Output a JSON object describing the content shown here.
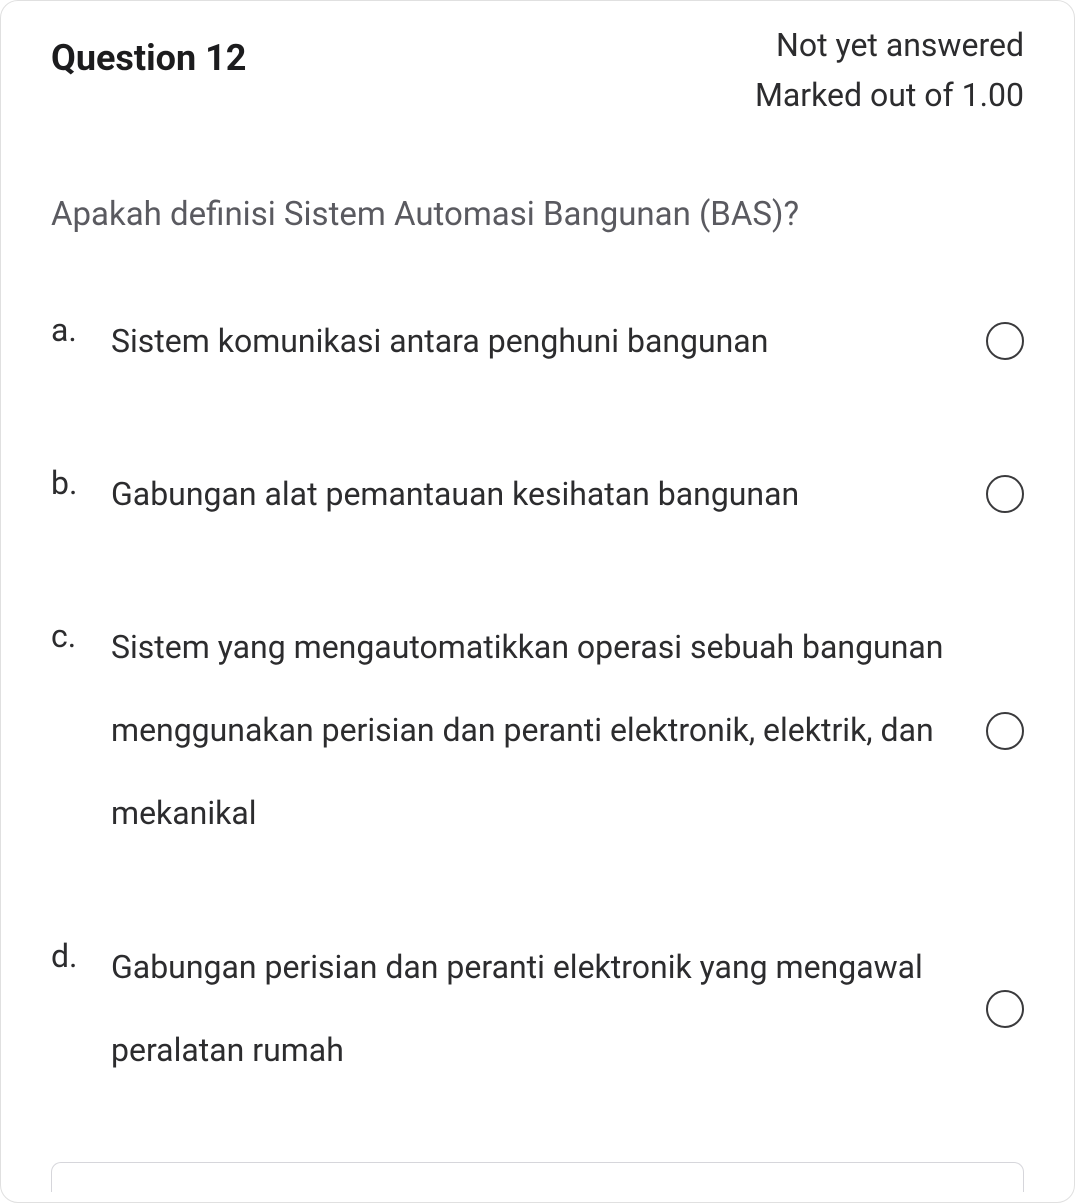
{
  "header": {
    "title": "Question 12",
    "status_line1": "Not yet answered",
    "status_line2": "Marked out of 1.00"
  },
  "question": {
    "text": "Apakah definisi Sistem Automasi Bangunan (BAS)?"
  },
  "options": [
    {
      "letter": "a.",
      "text": "Sistem komunikasi antara penghuni bangunan"
    },
    {
      "letter": "b.",
      "text": "Gabungan alat pemantauan kesihatan bangunan"
    },
    {
      "letter": "c.",
      "text": "Sistem yang mengautomatikkan operasi sebuah bangunan menggunakan perisian dan peranti elektronik, elektrik, dan mekanikal"
    },
    {
      "letter": "d.",
      "text": "Gabungan perisian dan peranti elektronik yang mengawal peralatan rumah"
    }
  ]
}
